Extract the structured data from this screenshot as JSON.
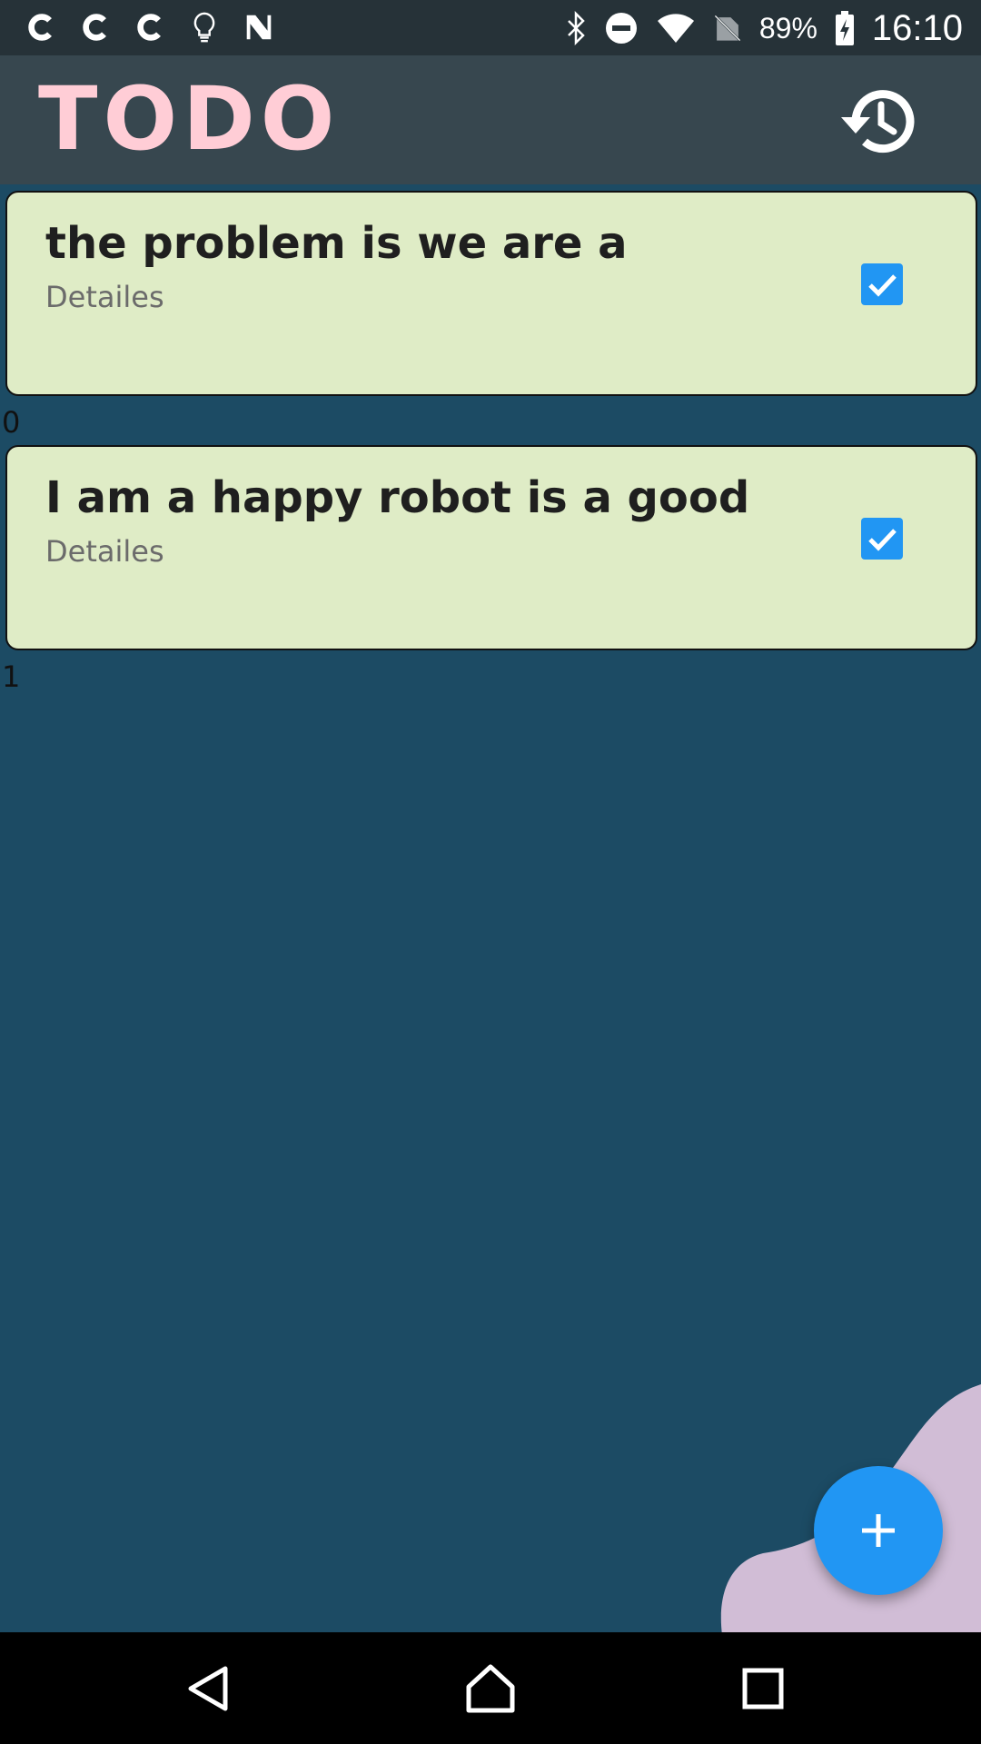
{
  "status_bar": {
    "left_icons": [
      "c-app-icon",
      "c-app-icon",
      "c-app-icon",
      "lightbulb-icon",
      "n-app-icon"
    ],
    "right_icons": [
      "bluetooth-icon",
      "do-not-disturb-icon",
      "wifi-icon",
      "no-sim-icon",
      "battery-charging-icon"
    ],
    "battery": "89%",
    "time": "16:10"
  },
  "app_bar": {
    "title": "TODO",
    "title_color": "#ffcdd6",
    "background": "#37474f",
    "history_icon": "history-icon"
  },
  "todos": [
    {
      "title": "the problem is we are a",
      "details": "Detailes",
      "checked": true,
      "index": "0"
    },
    {
      "title": "I am a happy robot is a good",
      "details": "Detailes",
      "checked": true,
      "index": "1"
    }
  ],
  "colors": {
    "page_background": "#1c4b64",
    "card_background": "#dfecc6",
    "checkbox": "#2196f3",
    "fab": "#2196f3",
    "blob": "#d1bdd6"
  },
  "fab": {
    "icon": "plus-icon"
  },
  "nav_bar": {
    "buttons": [
      "back-icon",
      "home-icon",
      "recents-icon"
    ]
  }
}
